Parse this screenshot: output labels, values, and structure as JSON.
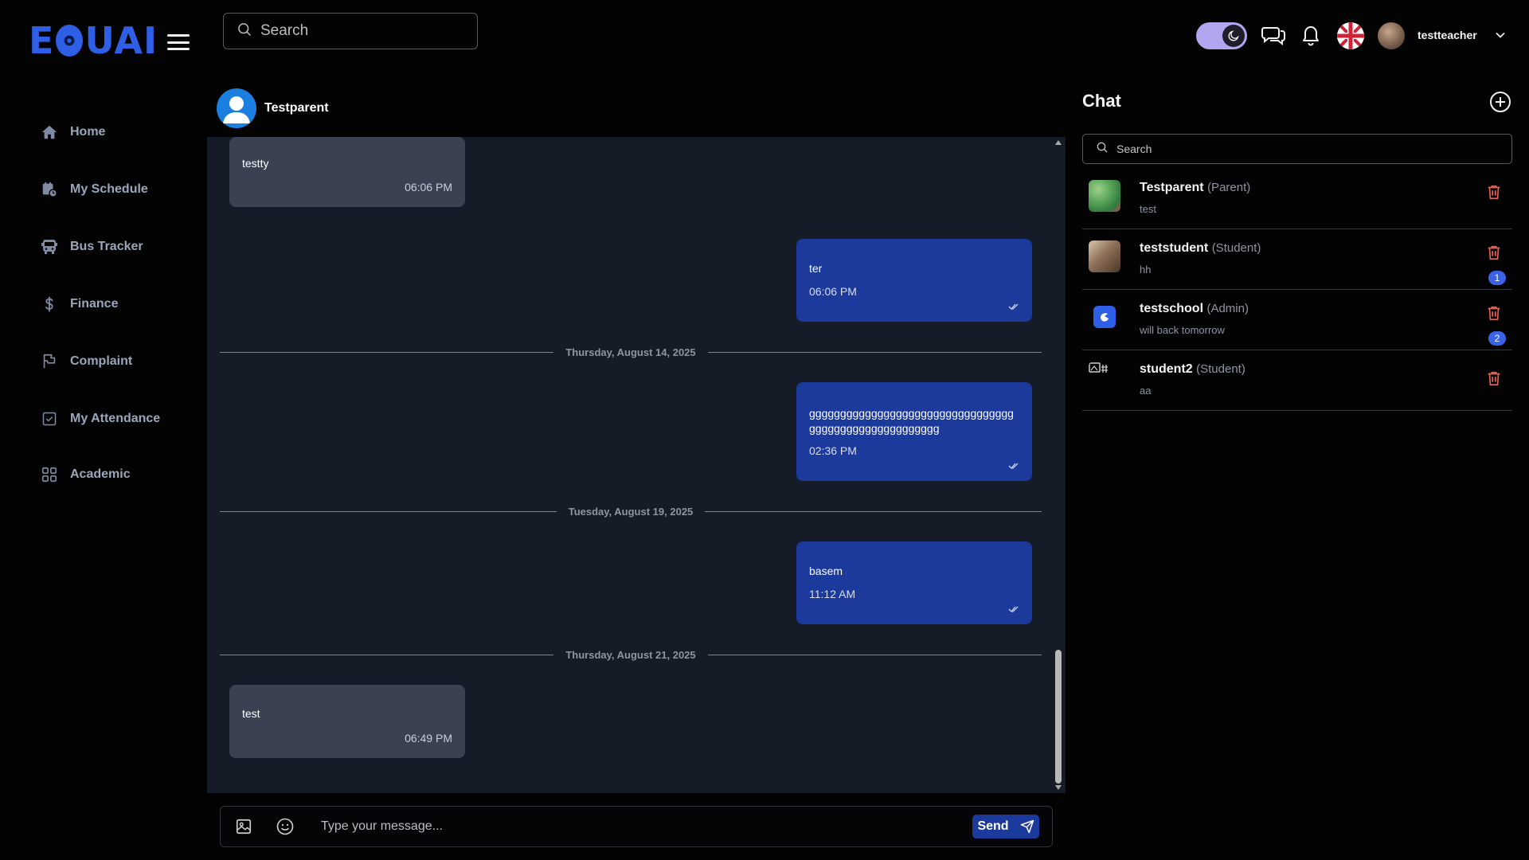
{
  "brand": {
    "logo_text_left": "E",
    "logo_text_right": "UAI"
  },
  "top": {
    "search_placeholder": "Search",
    "username": "testteacher"
  },
  "sidebar": {
    "items": [
      {
        "label": "Home",
        "icon": "home-icon"
      },
      {
        "label": "My Schedule",
        "icon": "calendar-clock-icon"
      },
      {
        "label": "Bus Tracker",
        "icon": "bus-icon"
      },
      {
        "label": "Finance",
        "icon": "dollar-icon"
      },
      {
        "label": "Complaint",
        "icon": "flag-icon"
      },
      {
        "label": "My Attendance",
        "icon": "checkbox-icon"
      },
      {
        "label": "Academic",
        "icon": "grid-icon"
      }
    ]
  },
  "chat": {
    "contact_name": "Testparent",
    "messages": [
      {
        "text": "testty",
        "time": "06:06 PM",
        "direction": "in"
      },
      {
        "text": "ter",
        "time": "06:06 PM",
        "direction": "out"
      },
      {
        "text": "gggggggggggggggggggggggggggggggggggggggggggggggggggggg",
        "time": "02:36 PM",
        "direction": "out"
      },
      {
        "text": "basem",
        "time": "11:12 AM",
        "direction": "out"
      },
      {
        "text": "test",
        "time": "06:49 PM",
        "direction": "in"
      }
    ],
    "dividers": [
      "Thursday, August 14, 2025",
      "Tuesday, August 19, 2025",
      "Thursday, August 21, 2025"
    ],
    "composer_placeholder": "Type your message...",
    "send_label": "Send"
  },
  "side": {
    "title": "Chat",
    "search_placeholder": "Search",
    "conversations": [
      {
        "name": "Testparent",
        "role": "(Parent)",
        "preview": "test",
        "unread": ""
      },
      {
        "name": "teststudent",
        "role": "(Student)",
        "preview": "hh",
        "unread": "1"
      },
      {
        "name": "testschool",
        "role": "(Admin)",
        "preview": "will back tomorrow",
        "unread": "2"
      },
      {
        "name": "student2",
        "role": "(Student)",
        "preview": "aa",
        "unread": ""
      }
    ]
  },
  "colors": {
    "accent": "#1c3a9c",
    "incoming_bubble": "#3a4150",
    "chat_bg": "#151b27",
    "badge": "#3a63e8",
    "delete": "#f25f4c",
    "toggle": "#b3a5f0"
  }
}
